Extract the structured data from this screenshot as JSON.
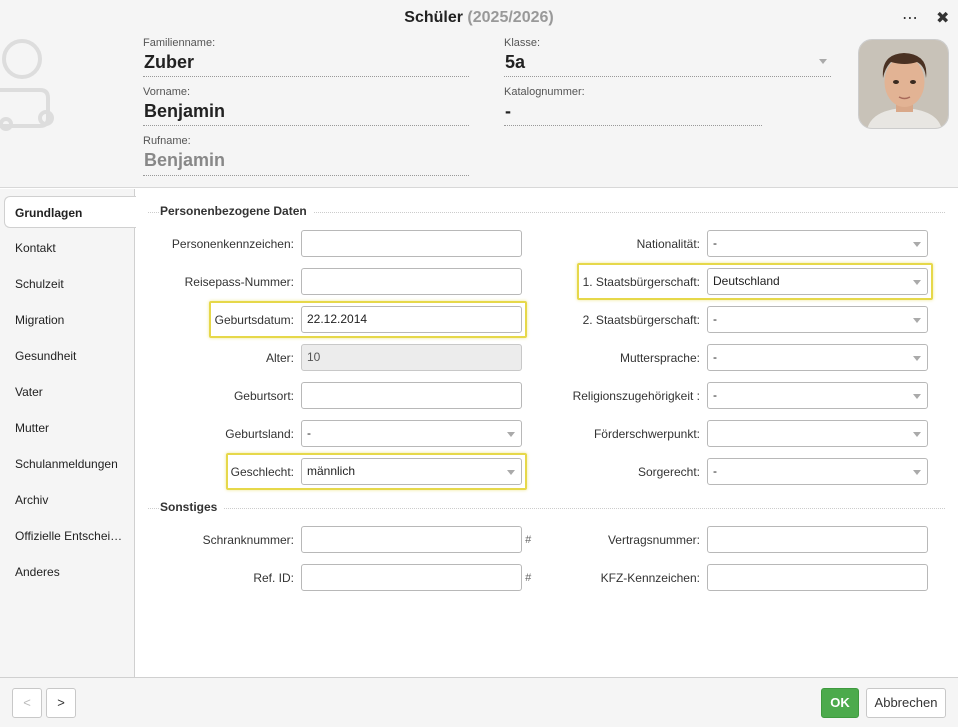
{
  "window": {
    "title": "Schüler",
    "year": "(2025/2026)",
    "menu_glyph": "⋯",
    "close_glyph": "✖"
  },
  "header": {
    "familienname": {
      "label": "Familienname:",
      "value": "Zuber"
    },
    "vorname": {
      "label": "Vorname:",
      "value": "Benjamin"
    },
    "rufname": {
      "label": "Rufname:",
      "value": "Benjamin"
    },
    "klasse": {
      "label": "Klasse:",
      "value": "5a"
    },
    "katalognummer": {
      "label": "Katalognummer:",
      "value": "-"
    }
  },
  "sidebar": {
    "items": [
      {
        "label": "Grundlagen",
        "active": true
      },
      {
        "label": "Kontakt"
      },
      {
        "label": "Schulzeit"
      },
      {
        "label": "Migration"
      },
      {
        "label": "Gesundheit"
      },
      {
        "label": "Vater"
      },
      {
        "label": "Mutter"
      },
      {
        "label": "Schulanmeldungen"
      },
      {
        "label": "Archiv"
      },
      {
        "label": "Offizielle Entschei…"
      },
      {
        "label": "Anderes"
      }
    ]
  },
  "sections": {
    "personal": "Personenbezogene Daten",
    "misc": "Sonstiges"
  },
  "fields": {
    "personenkennzeichen": {
      "label": "Personenkennzeichen:",
      "value": ""
    },
    "reisepass": {
      "label": "Reisepass-Nummer:",
      "value": ""
    },
    "geburtsdatum": {
      "label": "Geburtsdatum:",
      "value": "22.12.2014"
    },
    "alter": {
      "label": "Alter:",
      "value": "10"
    },
    "geburtsort": {
      "label": "Geburtsort:",
      "value": ""
    },
    "geburtsland": {
      "label": "Geburtsland:",
      "value": "-"
    },
    "geschlecht": {
      "label": "Geschlecht:",
      "value": "männlich"
    },
    "nationalitaet": {
      "label": "Nationalität:",
      "value": "-"
    },
    "staatsb1": {
      "label": "1. Staatsbürgerschaft:",
      "value": "Deutschland"
    },
    "staatsb2": {
      "label": "2. Staatsbürgerschaft:",
      "value": "-"
    },
    "muttersprache": {
      "label": "Muttersprache:",
      "value": "-"
    },
    "religion": {
      "label": "Religionszugehörigkeit :",
      "value": "-"
    },
    "foerder": {
      "label": "Förderschwerpunkt:",
      "value": ""
    },
    "sorgerecht": {
      "label": "Sorgerecht:",
      "value": "-"
    },
    "schrank": {
      "label": "Schranknummer:",
      "value": "",
      "suffix": "#"
    },
    "refid": {
      "label": "Ref. ID:",
      "value": "",
      "suffix": "#"
    },
    "vertrag": {
      "label": "Vertragsnummer:",
      "value": ""
    },
    "kfz": {
      "label": "KFZ-Kennzeichen:",
      "value": ""
    }
  },
  "footer": {
    "prev": "<",
    "next": ">",
    "ok": "OK",
    "cancel": "Abbrechen"
  },
  "colors": {
    "highlight": "#e6d84a",
    "ok_button": "#4caa4c"
  },
  "icons": {
    "placeholder": "user-placeholder-icon",
    "photo": "student-photo"
  }
}
